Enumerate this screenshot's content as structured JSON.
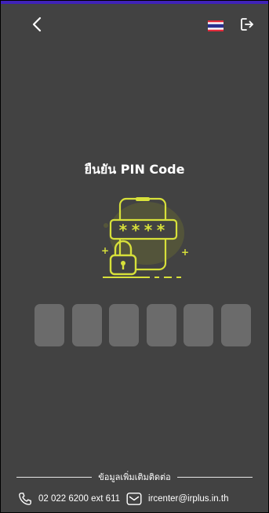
{
  "header": {
    "back_icon": "chevron-left-icon",
    "language_flag": "thai-flag-icon",
    "logout_icon": "logout-icon"
  },
  "page": {
    "title": "ยืนยัน PIN Code",
    "illustration_text": "****",
    "illustration_icon": "phone-lock-icon"
  },
  "pin": {
    "slots": [
      "",
      "",
      "",
      "",
      "",
      ""
    ]
  },
  "contact": {
    "label": "ข้อมูลเพิ่มเติมติดต่อ",
    "phone": "02 022 6200 ext 611",
    "email": "ircenter@irplus.in.th"
  },
  "colors": {
    "background": "#424242",
    "accent": "#d7e03a",
    "pin_box": "#6b6b6b",
    "top_bar": "#3f22b8",
    "flag_red": "#e12b3a",
    "flag_white": "#ffffff",
    "flag_blue": "#2a2f8f"
  }
}
